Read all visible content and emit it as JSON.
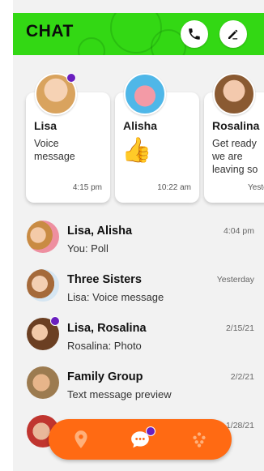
{
  "header": {
    "title": "CHAT",
    "color": "#33d814"
  },
  "stories": [
    {
      "name": "Lisa",
      "message": "Voice\nmessage",
      "time": "4:15 pm",
      "online": true
    },
    {
      "name": "Alisha",
      "message": "",
      "sticker": "👍",
      "time": "10:22 am",
      "online": false
    },
    {
      "name": "Rosalina",
      "message": "Get ready\nwe are\nleaving so",
      "time": "Yesterd",
      "online": false
    }
  ],
  "conversations": [
    {
      "name": "Lisa, Alisha",
      "preview": "You: Poll",
      "time": "4:04 pm",
      "online": false
    },
    {
      "name": "Three Sisters",
      "preview": "Lisa: Voice message",
      "time": "Yesterday",
      "online": false
    },
    {
      "name": "Lisa, Rosalina",
      "preview": "Rosalina: Photo",
      "time": "2/15/21",
      "online": true
    },
    {
      "name": "Family Group",
      "preview": "Text message preview",
      "time": "2/2/21",
      "online": false
    },
    {
      "name": "",
      "preview": "",
      "time": "1/28/21",
      "online": false
    }
  ],
  "nav": {
    "items": [
      "location-icon",
      "chat-icon",
      "apps-icon"
    ],
    "active": "chat-icon",
    "accent": "#ff6a13",
    "badge_color": "#6a1fbf"
  },
  "icons": {
    "call": "phone-icon",
    "compose": "pencil-icon"
  }
}
